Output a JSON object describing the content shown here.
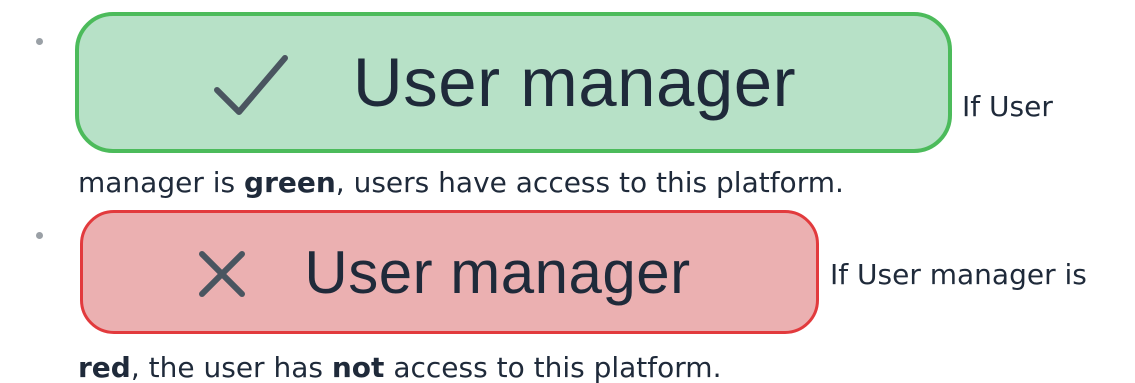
{
  "items": [
    {
      "badge": {
        "icon": "checkmark-icon",
        "label": "User manager",
        "fill_color": "#b7e1c7",
        "border_color": "#4cbb5b"
      },
      "text_lead": "If User",
      "text_cont": "manager is",
      "text_bold": "green",
      "text_rest": ", users have access to this platform."
    },
    {
      "badge": {
        "icon": "cross-icon",
        "label": "User manager",
        "fill_color": "#ebb0b1",
        "border_color": "#e23a3d"
      },
      "text_lead": "If User manager is",
      "text_bold": "red",
      "text_mid": ", the user has",
      "text_bold2": "not",
      "text_rest": "access to this platform."
    }
  ]
}
